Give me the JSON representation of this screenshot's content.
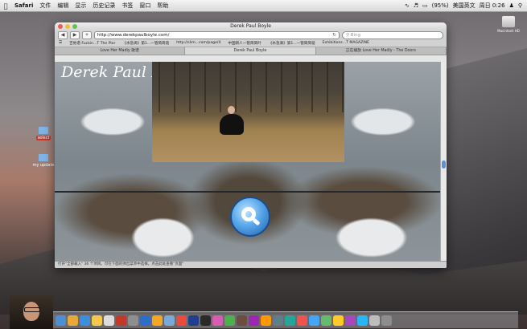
{
  "menubar": {
    "app": "Safari",
    "items": [
      "文件",
      "编辑",
      "显示",
      "历史记录",
      "书签",
      "窗口",
      "帮助"
    ],
    "status": {
      "battery": "(95%)",
      "input": "美国英文",
      "clock": "周日 0:26"
    }
  },
  "desktop": {
    "icons": [
      {
        "label": "select"
      },
      {
        "label": "my update"
      }
    ],
    "hd_label": "Macintosh HD"
  },
  "window": {
    "title": "Derek Paul Boyle",
    "url": "http://www.derekpaulboyle.com/",
    "search_placeholder": "Bing",
    "bookmarks": [
      "吉他谱 Fuckin...T The Pier",
      "《水急滴》第1...一管简简谐",
      "http://slim...com/page/4",
      "中国新人一管简简叶",
      "《水急滴》第1...一管简简谐",
      "Exhibitions...T MAGAZINE"
    ],
    "tabs": [
      {
        "label": "Love Her Madly 歌谱",
        "active": false
      },
      {
        "label": "Derek Paul Boyle",
        "active": true
      },
      {
        "label": "正在播放 Love Her Madly - The Doors",
        "active": false
      }
    ],
    "page": {
      "site_title": "Derek Paul Boyle"
    },
    "status_text": "打开\"全部载入\" 36 个项目。可在下面的弹出菜单中选择。点击此处查看\"页面\""
  },
  "colors": {
    "accent": "#5aa8ea",
    "brand": "#ffffff"
  }
}
